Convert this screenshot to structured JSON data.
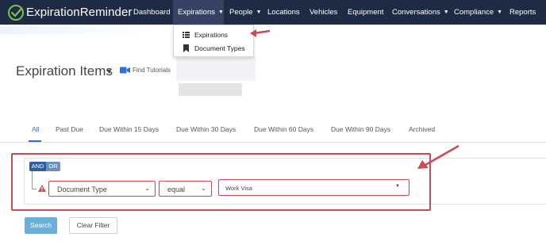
{
  "app": {
    "logo_text": "ExpirationReminder",
    "brand_color": "#1f2a44",
    "accent_color": "#2f6fdc",
    "annotation_color": "#c94b55"
  },
  "nav": {
    "items": [
      {
        "label": "Dashboard",
        "has_caret": false
      },
      {
        "label": "Expirations",
        "has_caret": true,
        "active": true
      },
      {
        "label": "People",
        "has_caret": true
      },
      {
        "label": "Locations",
        "has_caret": false
      },
      {
        "label": "Vehicles",
        "has_caret": false
      },
      {
        "label": "Equipment",
        "has_caret": false
      },
      {
        "label": "Conversations",
        "has_caret": true
      },
      {
        "label": "Compliance",
        "has_caret": true
      },
      {
        "label": "Reports",
        "has_caret": false
      }
    ],
    "dropdown": [
      {
        "label": "Expirations",
        "icon": "list-icon"
      },
      {
        "label": "Document Types",
        "icon": "bookmark-icon"
      }
    ]
  },
  "page": {
    "title": "Expiration Items",
    "tutorial_link": "Find Tutorials"
  },
  "tabs": [
    {
      "label": "All",
      "active": true
    },
    {
      "label": "Past Due"
    },
    {
      "label": "Due Within 15 Days"
    },
    {
      "label": "Due Within 30 Days"
    },
    {
      "label": "Due Within 60 Days"
    },
    {
      "label": "Due Within 90 Days"
    },
    {
      "label": "Archived"
    }
  ],
  "filter": {
    "and_label": "AND",
    "or_label": "OR",
    "field_value": "Document Type",
    "operator_value": "equal",
    "value_value": "Work Visa"
  },
  "buttons": {
    "search": "Search",
    "clear": "Clear Filter"
  }
}
